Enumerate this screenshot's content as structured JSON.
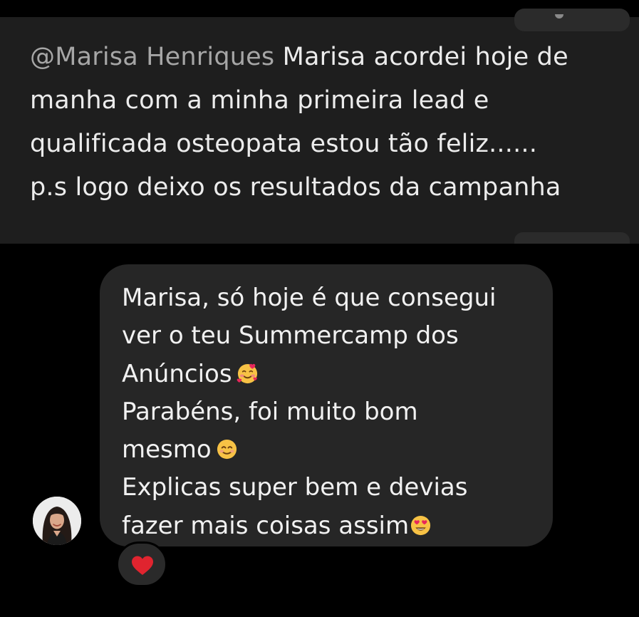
{
  "comment": {
    "mention": "@Marisa Henriques",
    "line1_text": " Marisa acordei hoje de",
    "line2": "manha com a minha primeira lead e",
    "line3": "qualificada osteopata estou tão feliz......",
    "line4": "p.s logo deixo os resultados da campanha"
  },
  "message": {
    "lines": [
      "Marisa, só hoje é que consegui",
      "ver o teu Summercamp dos",
      "Anúncios",
      "Parabéns, foi muito bom",
      "mesmo",
      "Explicas super bem e devias",
      "fazer mais coisas assim"
    ],
    "emojis": [
      "smiling-face-with-hearts",
      "smiling-face",
      "heart-eyes-face"
    ]
  },
  "reaction": {
    "icon": "red-heart",
    "color": "#e0242f"
  },
  "colors": {
    "background": "#000000",
    "comment_card": "#1e1e1e",
    "bubble": "#262626",
    "mention": "#a6a6a6",
    "text": "#f1f1f1"
  }
}
